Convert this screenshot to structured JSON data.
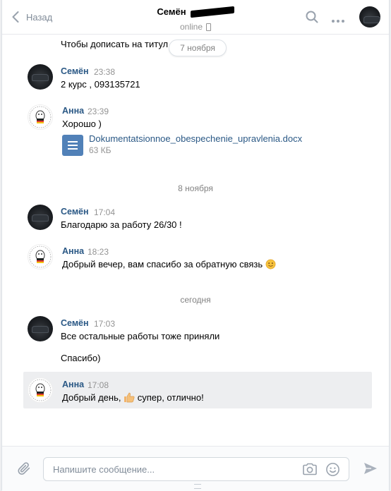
{
  "header": {
    "back_label": "Назад",
    "contact_name": "Семён",
    "status": "online"
  },
  "truncated_text": "Чтобы дописать на титул",
  "floating_date": "7 ноября",
  "dates": {
    "d8": "8 ноября",
    "today": "сегодня"
  },
  "messages": [
    {
      "author": "Семён",
      "time": "23:38",
      "text": "2 курс , 093135721"
    },
    {
      "author": "Анна",
      "time": "23:39",
      "text": "Хорошо )",
      "attachment": {
        "name": "Dokumentatsionnoe_obespechenie_upravlenia.docx",
        "size": "63 КБ"
      }
    },
    {
      "author": "Семён",
      "time": "17:04",
      "text": "Благодарю за работу 26/30 !"
    },
    {
      "author": "Анна",
      "time": "18:23",
      "text": "Добрый вечер, вам спасибо за обратную связь"
    },
    {
      "author": "Семён",
      "time": "17:03",
      "text": "Все остальные работы тоже приняли",
      "text2": "Спасибо)"
    },
    {
      "author": "Анна",
      "time": "17:08",
      "text_a": "Добрый день,",
      "text_b": "супер, отлично!"
    }
  ],
  "composer": {
    "placeholder": "Напишите сообщение..."
  },
  "colors": {
    "link": "#2a5885",
    "accent": "#5181b8",
    "muted": "#939393",
    "highlight": "#edeef0"
  },
  "icons": [
    "back-chevron-icon",
    "phone-icon",
    "search-icon",
    "more-icon",
    "document-icon",
    "smile-emoji-icon",
    "thumbs-up-emoji-icon",
    "paperclip-icon",
    "camera-icon",
    "emoji-icon",
    "send-icon"
  ]
}
